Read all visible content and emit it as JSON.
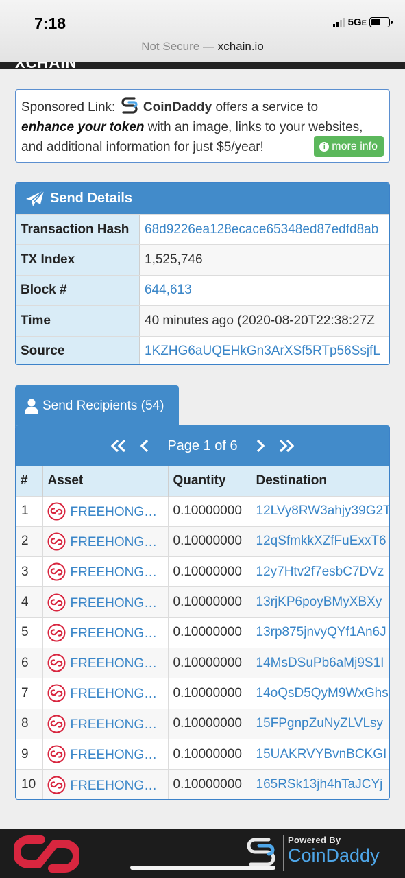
{
  "status_bar": {
    "time": "7:18",
    "network": "5G",
    "network_suffix": "E"
  },
  "address_bar": {
    "security": "Not Secure —",
    "domain": "xchain.io"
  },
  "site": {
    "brand_partial": "XCHAIN"
  },
  "sponsored": {
    "prefix": "Sponsored Link:",
    "name": "CoinDaddy",
    "text1": "offers a service to",
    "link": "enhance your token",
    "text2": "with an image, links to your websites,",
    "text3": "and additional information for just $5/year!",
    "button": "more info"
  },
  "send_details": {
    "title": "Send Details",
    "rows": [
      {
        "label": "Transaction Hash",
        "value": "68d9226ea128ecace65348ed87edfd8ab"
      },
      {
        "label": "TX Index",
        "value": "1,525,746"
      },
      {
        "label": "Block #",
        "value": "644,613"
      },
      {
        "label": "Time",
        "value": "40 minutes ago (2020-08-20T22:38:27Z"
      },
      {
        "label": "Source",
        "value": "1KZHG6aUQEHkGn3ArXSf5RTp56SsjfL"
      }
    ]
  },
  "recipients": {
    "tab_label": "Send Recipients (54)",
    "pager": {
      "label": "Page 1 of 6"
    },
    "columns": [
      "#",
      "Asset",
      "Quantity",
      "Destination"
    ],
    "rows": [
      {
        "n": "1",
        "asset": "FREEHONG…",
        "qty": "0.10000000",
        "dest": "12LVy8RW3ahjy39G2T"
      },
      {
        "n": "2",
        "asset": "FREEHONG…",
        "qty": "0.10000000",
        "dest": "12qSfmkkXZfFuExxT6"
      },
      {
        "n": "3",
        "asset": "FREEHONG…",
        "qty": "0.10000000",
        "dest": "12y7Htv2f7esbC7DVz"
      },
      {
        "n": "4",
        "asset": "FREEHONG…",
        "qty": "0.10000000",
        "dest": "13rjKP6poyBMyXBXy"
      },
      {
        "n": "5",
        "asset": "FREEHONG…",
        "qty": "0.10000000",
        "dest": "13rp875jnvyQYf1An6J"
      },
      {
        "n": "6",
        "asset": "FREEHONG…",
        "qty": "0.10000000",
        "dest": "14MsDSuPb6aMj9S1I"
      },
      {
        "n": "7",
        "asset": "FREEHONG…",
        "qty": "0.10000000",
        "dest": "14oQsD5QyM9WxGhs"
      },
      {
        "n": "8",
        "asset": "FREEHONG…",
        "qty": "0.10000000",
        "dest": "15FPgnpZuNyZLVLsy"
      },
      {
        "n": "9",
        "asset": "FREEHONG…",
        "qty": "0.10000000",
        "dest": "15UAKRVYBvnBCKGI"
      },
      {
        "n": "10",
        "asset": "FREEHONG…",
        "qty": "0.10000000",
        "dest": "165RSk13jh4hTaJCYj"
      }
    ]
  },
  "footer": {
    "powered_by": "Powered By",
    "brand": "CoinDaddy"
  },
  "colors": {
    "primary": "#428bca",
    "link": "#3a86c8",
    "success": "#5cb85c",
    "label_bg": "#d9ecf7",
    "asset_icon": "#d8263f"
  }
}
